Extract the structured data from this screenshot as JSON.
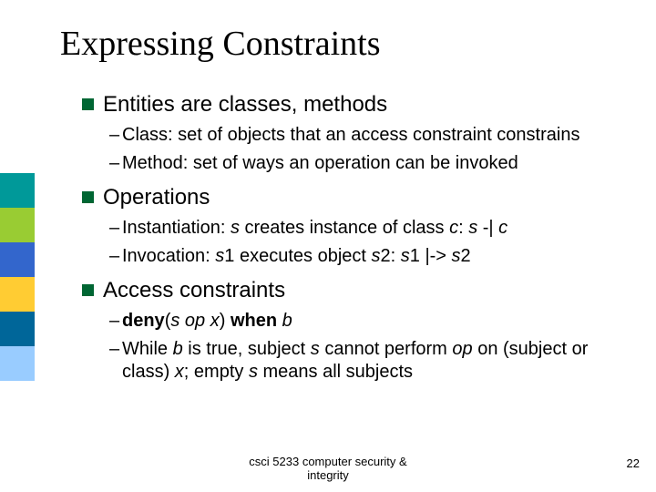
{
  "sidebar_colors": [
    "#009999",
    "#99cc33",
    "#3366cc",
    "#ffcc33",
    "#006699",
    "#99ccff"
  ],
  "title": "Expressing Constraints",
  "bullets": [
    {
      "text": "Entities are classes, methods",
      "subs": [
        {
          "parts": [
            {
              "t": "Class: set of objects that an access constraint constrains"
            }
          ]
        },
        {
          "parts": [
            {
              "t": "Method: set of ways an operation can be invoked"
            }
          ]
        }
      ]
    },
    {
      "text": "Operations",
      "subs": [
        {
          "parts": [
            {
              "t": "Instantiation: "
            },
            {
              "t": "s",
              "i": true
            },
            {
              "t": " creates instance of class "
            },
            {
              "t": "c",
              "i": true
            },
            {
              "t": ": "
            },
            {
              "t": "s",
              "i": true
            },
            {
              "t": " -| "
            },
            {
              "t": "c",
              "i": true
            }
          ]
        },
        {
          "parts": [
            {
              "t": "Invocation: "
            },
            {
              "t": "s",
              "i": true
            },
            {
              "t": "1 executes object "
            },
            {
              "t": "s",
              "i": true
            },
            {
              "t": "2: "
            },
            {
              "t": "s",
              "i": true
            },
            {
              "t": "1 |-> "
            },
            {
              "t": "s",
              "i": true
            },
            {
              "t": "2"
            }
          ]
        }
      ]
    },
    {
      "text": "Access constraints",
      "subs": [
        {
          "parts": [
            {
              "t": "deny",
              "b": true
            },
            {
              "t": "("
            },
            {
              "t": "s op x",
              "i": true
            },
            {
              "t": ") "
            },
            {
              "t": "when",
              "b": true
            },
            {
              "t": " "
            },
            {
              "t": "b",
              "i": true
            }
          ]
        },
        {
          "parts": [
            {
              "t": "While "
            },
            {
              "t": "b",
              "i": true
            },
            {
              "t": " is true, subject "
            },
            {
              "t": "s",
              "i": true
            },
            {
              "t": " cannot perform "
            },
            {
              "t": "op",
              "i": true
            },
            {
              "t": " on (subject or class) "
            },
            {
              "t": "x",
              "i": true
            },
            {
              "t": "; empty "
            },
            {
              "t": "s",
              "i": true
            },
            {
              "t": " means all subjects"
            }
          ]
        }
      ]
    }
  ],
  "footer_line1": "csci 5233 computer security &",
  "footer_line2": "integrity",
  "page_number": "22"
}
